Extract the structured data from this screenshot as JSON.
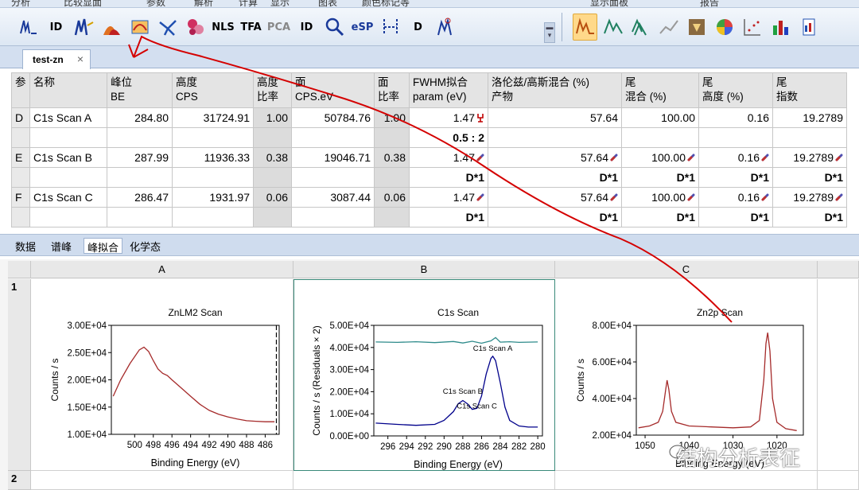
{
  "menu": {
    "items": [
      "分析",
      "比较显面",
      "参数",
      "解析",
      "计算",
      "显示",
      "图表",
      "颜色标记等",
      "显示面板",
      "报告"
    ]
  },
  "toolbar": {
    "text_buttons": {
      "id": "ID",
      "nls": "NLS",
      "tfa": "TFA",
      "pca": "PCA",
      "id2": "ID",
      "esp": "eSP",
      "d": "D"
    }
  },
  "doc_tab": {
    "label": "test-zn",
    "close": "×"
  },
  "params": {
    "headers": [
      {
        "a": "参",
        "b": ""
      },
      {
        "a": "名称",
        "b": ""
      },
      {
        "a": "峰位",
        "b": "BE"
      },
      {
        "a": "高度",
        "b": "CPS"
      },
      {
        "a": "高度",
        "b": "比率"
      },
      {
        "a": "面",
        "b": "CPS.eV"
      },
      {
        "a": "面",
        "b": "比率"
      },
      {
        "a": "FWHM拟合",
        "b": "param (eV)"
      },
      {
        "a": "洛伦兹/高斯混合 (%)",
        "b": "产物"
      },
      {
        "a": "尾",
        "b": "混合 (%)"
      },
      {
        "a": "尾",
        "b": "高度 (%)"
      },
      {
        "a": "尾",
        "b": "指数"
      }
    ],
    "rows": [
      {
        "id": "D",
        "name": "C1s Scan A",
        "be": "284.80",
        "height": "31724.91",
        "hratio": "1.00",
        "area": "50784.76",
        "aratio": "1.00",
        "fwhm": "1.47",
        "lg": "57.64",
        "tmix": "100.00",
        "theight": "0.16",
        "texp": "19.2789",
        "c_fwhm": "0.5 : 2",
        "c_lg": "",
        "c_tmix": "",
        "c_theight": "",
        "c_texp": ""
      },
      {
        "id": "E",
        "name": "C1s Scan B",
        "be": "287.99",
        "height": "11936.33",
        "hratio": "0.38",
        "area": "19046.71",
        "aratio": "0.38",
        "fwhm": "1.47",
        "lg": "57.64",
        "tmix": "100.00",
        "theight": "0.16",
        "texp": "19.2789",
        "c_fwhm": "D*1",
        "c_lg": "D*1",
        "c_tmix": "D*1",
        "c_theight": "D*1",
        "c_texp": "D*1"
      },
      {
        "id": "F",
        "name": "C1s Scan C",
        "be": "286.47",
        "height": "1931.97",
        "hratio": "0.06",
        "area": "3087.44",
        "aratio": "0.06",
        "fwhm": "1.47",
        "lg": "57.64",
        "tmix": "100.00",
        "theight": "0.16",
        "texp": "19.2789",
        "c_fwhm": "D*1",
        "c_lg": "D*1",
        "c_tmix": "D*1",
        "c_theight": "D*1",
        "c_texp": "D*1"
      }
    ]
  },
  "subtabs": [
    "数据",
    "谱峰",
    "峰拟合",
    "化学态"
  ],
  "active_subtab": "峰拟合",
  "sheet": {
    "columns": [
      "A",
      "B",
      "C"
    ],
    "rows": [
      "1",
      "2"
    ]
  },
  "chart_data": [
    {
      "type": "line",
      "title": "ZnLM2 Scan",
      "xlabel": "Binding Energy (eV)",
      "ylabel": "Counts / s",
      "xlim": [
        502.5,
        484.5
      ],
      "ylim": [
        10000,
        30000
      ],
      "xticks": [
        "500",
        "498",
        "496",
        "494",
        "492",
        "490",
        "488",
        "486"
      ],
      "yticks": [
        "1.00E+04",
        "1.50E+04",
        "2.00E+04",
        "2.50E+04",
        "3.00E+04"
      ],
      "series": [
        {
          "color": "#a52a2a",
          "x": [
            502.3,
            501.5,
            500.5,
            499.5,
            499.0,
            498.5,
            498.0,
            497.5,
            497.0,
            496.5,
            496.0,
            495.0,
            494.0,
            493.0,
            492.0,
            491.0,
            490.0,
            489.0,
            488.0,
            487.0,
            486.0,
            485.0
          ],
          "y": [
            17000,
            20000,
            23000,
            25500,
            26000,
            25200,
            23500,
            22000,
            21200,
            20800,
            20000,
            18500,
            17000,
            15500,
            14400,
            13700,
            13200,
            12800,
            12500,
            12400,
            12300,
            12300
          ]
        }
      ],
      "vline_x": 484.8
    },
    {
      "type": "line",
      "title": "C1s Scan",
      "xlabel": "Binding Energy (eV)",
      "ylabel": "Counts / s  (Residuals × 2)",
      "xlim": [
        297.5,
        279.5
      ],
      "ylim": [
        0,
        50000
      ],
      "xticks": [
        "296",
        "294",
        "292",
        "290",
        "288",
        "286",
        "284",
        "282",
        "280"
      ],
      "yticks": [
        "0.00E+00",
        "1.00E+04",
        "2.00E+04",
        "3.00E+04",
        "4.00E+04",
        "5.00E+04"
      ],
      "series": [
        {
          "name": "envelope",
          "color": "#00008b",
          "x": [
            297.3,
            295,
            293,
            291,
            290,
            289,
            288.5,
            288,
            287.5,
            287,
            286.5,
            286,
            285.5,
            285,
            284.8,
            284.5,
            284,
            283.5,
            283,
            282,
            281,
            280
          ],
          "y": [
            5800,
            5200,
            4800,
            5200,
            7000,
            11000,
            14500,
            16000,
            14500,
            12000,
            12500,
            18000,
            28000,
            35000,
            36000,
            34000,
            24000,
            13000,
            7000,
            4500,
            4000,
            4000
          ]
        },
        {
          "name": "residual",
          "color": "#2e8b8b",
          "x": [
            297.3,
            295,
            293,
            291,
            289,
            288,
            287,
            286,
            285,
            284.5,
            284,
            283,
            282,
            280
          ],
          "y": [
            42500,
            42300,
            42600,
            42200,
            42700,
            42000,
            42800,
            41900,
            43000,
            44500,
            42400,
            42600,
            42300,
            42500
          ]
        }
      ],
      "peak_labels": [
        {
          "text": "C1s Scan A",
          "x": 284.8,
          "y": 38500
        },
        {
          "text": "C1s Scan B",
          "x": 288.0,
          "y": 19000
        },
        {
          "text": "C1s Scan C",
          "x": 286.5,
          "y": 12500
        }
      ]
    },
    {
      "type": "line",
      "title": "Zn2p Scan",
      "xlabel": "Binding Energy (eV)",
      "ylabel": "Counts / s",
      "xlim": [
        1052,
        1014
      ],
      "ylim": [
        20000,
        80000
      ],
      "xticks": [
        "1050",
        "1040",
        "1030",
        "1020"
      ],
      "yticks": [
        "2.00E+04",
        "4.00E+04",
        "6.00E+04",
        "8.00E+04"
      ],
      "series": [
        {
          "color": "#a52a2a",
          "x": [
            1051.5,
            1049,
            1047,
            1046,
            1045.3,
            1045.0,
            1044.6,
            1044,
            1043,
            1040,
            1035,
            1030,
            1026,
            1024,
            1023,
            1022.5,
            1022.1,
            1021.6,
            1021,
            1020,
            1018,
            1015.5
          ],
          "y": [
            24000,
            25000,
            27000,
            33000,
            45000,
            50000,
            45000,
            33000,
            27000,
            25000,
            24500,
            24000,
            24500,
            28000,
            50000,
            70000,
            76000,
            66000,
            40000,
            27000,
            23500,
            22500
          ]
        }
      ]
    }
  ],
  "watermark": {
    "text": "结构分析表征"
  },
  "colors": {
    "accent": "#ffd98a",
    "annotation": "#d40000",
    "curve_red": "#a52a2a",
    "curve_blue": "#00008b"
  }
}
